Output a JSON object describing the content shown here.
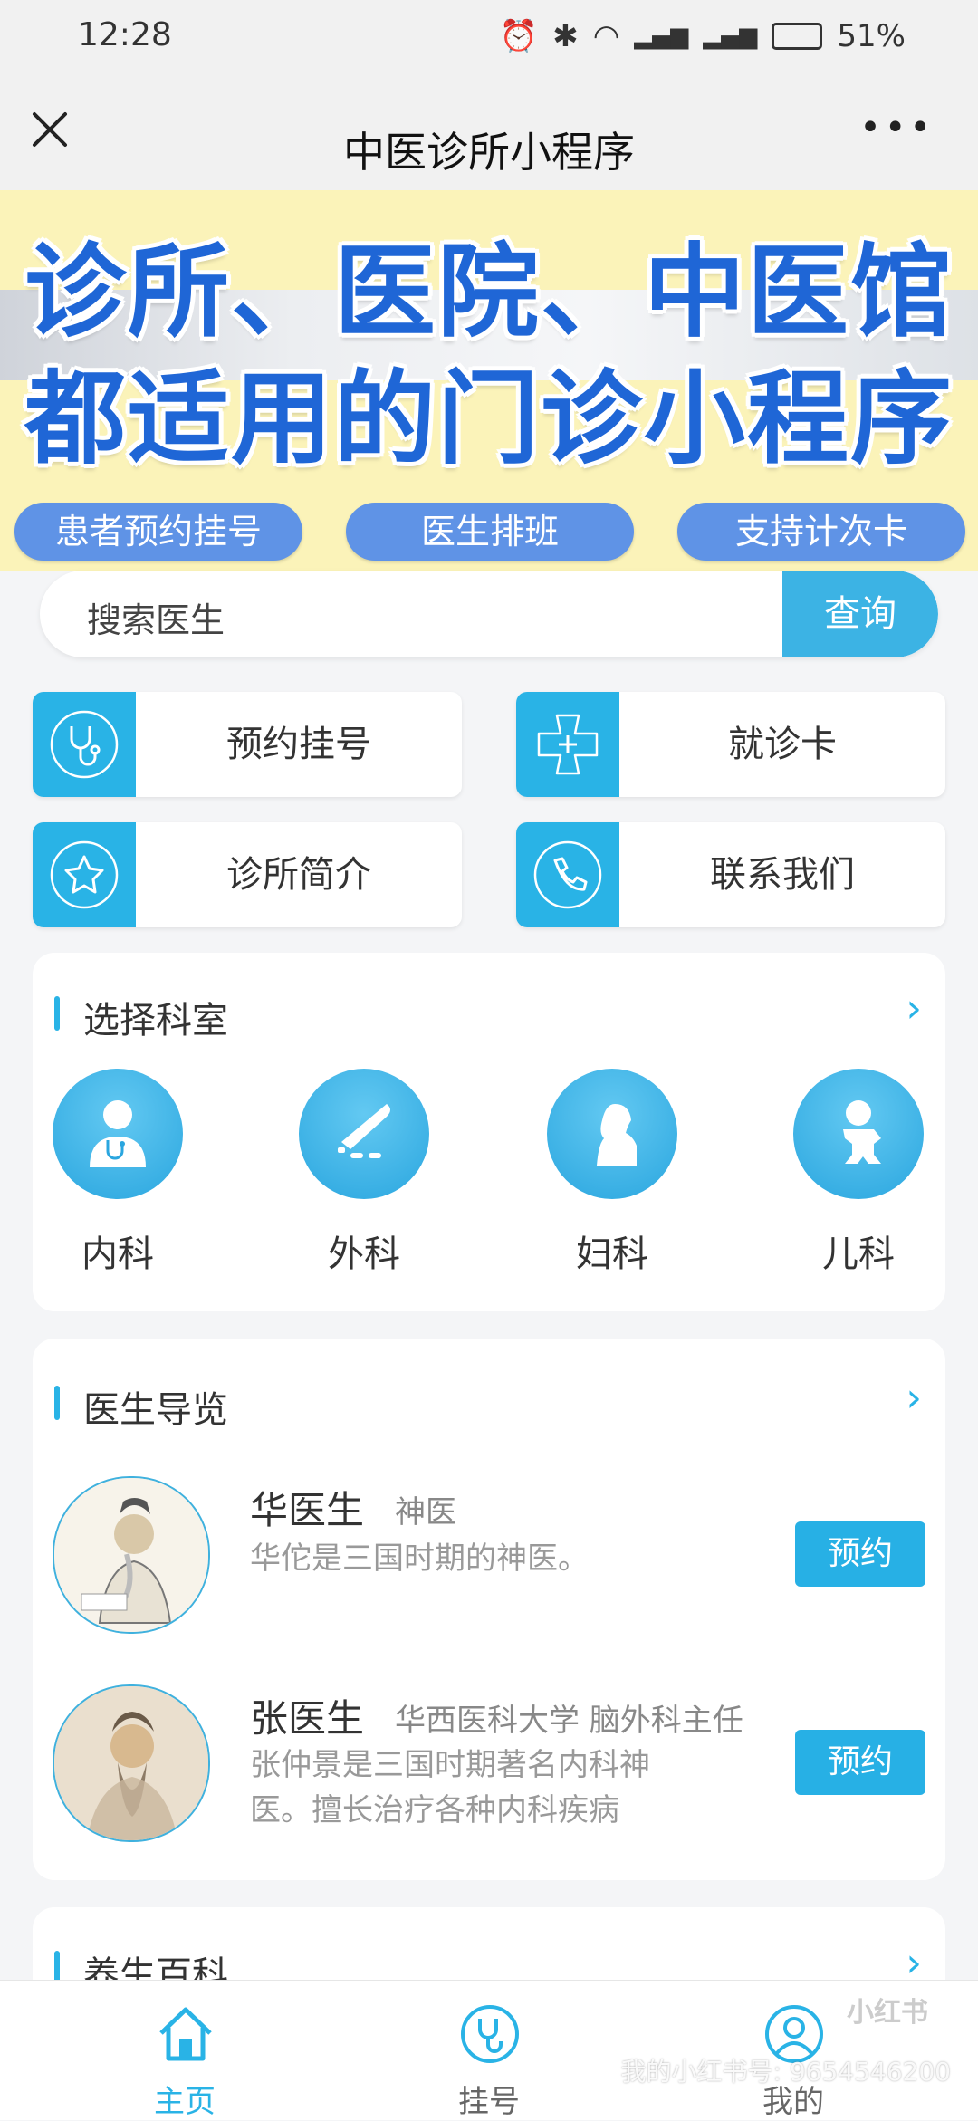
{
  "status_bar": {
    "time": "12:28",
    "battery": "51%"
  },
  "nav": {
    "title": "中医诊所小程序"
  },
  "banner": {
    "headline_1": "诊所、医院、中医馆",
    "headline_2": "都适用的门诊小程序",
    "tags": [
      "患者预约挂号",
      "医生排班",
      "支持计次卡"
    ]
  },
  "search": {
    "placeholder": "搜索医生",
    "button": "查询"
  },
  "quick": [
    {
      "label": "预约挂号",
      "icon": "stethoscope-icon"
    },
    {
      "label": "就诊卡",
      "icon": "medical-cross-icon"
    },
    {
      "label": "诊所简介",
      "icon": "star-icon"
    },
    {
      "label": "联系我们",
      "icon": "phone-icon"
    }
  ],
  "departments": {
    "title": "选择科室",
    "items": [
      {
        "label": "内科",
        "icon": "doctor-icon"
      },
      {
        "label": "外科",
        "icon": "scalpel-icon"
      },
      {
        "label": "妇科",
        "icon": "woman-icon"
      },
      {
        "label": "儿科",
        "icon": "baby-icon"
      }
    ]
  },
  "doctors": {
    "title": "医生导览",
    "items": [
      {
        "name": "华医生",
        "title": "神医",
        "desc": "华佗是三国时期的神医。",
        "button": "预约"
      },
      {
        "name": "张医生",
        "title": "华西医科大学 脑外科主任",
        "desc_1": "张仲景是三国时期著名内科神",
        "desc_2": "医。擅长治疗各种内科疾病",
        "button": "预约"
      }
    ]
  },
  "wellness": {
    "title": "养生百科"
  },
  "tabbar": {
    "items": [
      {
        "label": "主页",
        "icon": "home-icon",
        "active": true
      },
      {
        "label": "挂号",
        "icon": "stethoscope-icon",
        "active": false
      },
      {
        "label": "我的",
        "icon": "user-icon",
        "active": false
      }
    ]
  },
  "watermark": {
    "logo": "小红书",
    "text": "我的小红书号: 9654546200"
  },
  "colors": {
    "accent": "#29b3e6",
    "banner_blue": "#1f66d6",
    "banner_bg": "#fbf3b9"
  }
}
